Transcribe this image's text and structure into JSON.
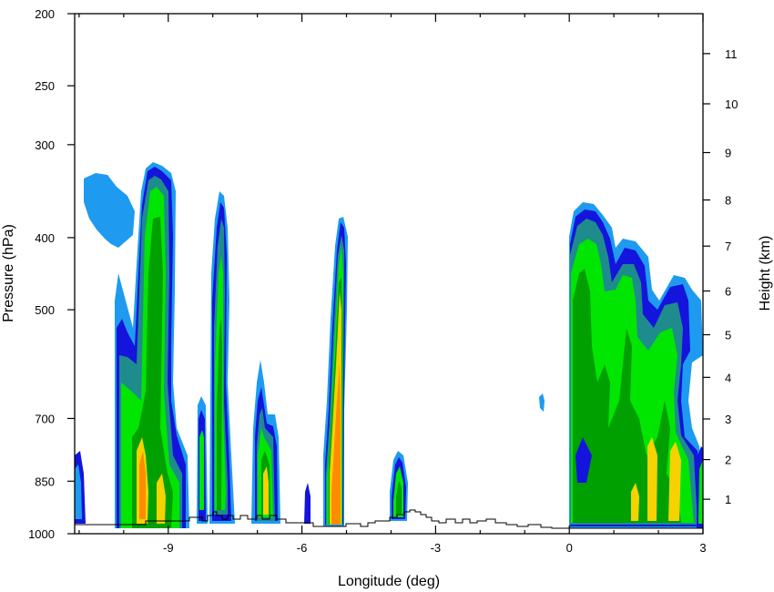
{
  "chart_data": {
    "type": "heatmap",
    "subtype": "filled-contour cross-section",
    "xlabel": "Longitude (deg)",
    "ylabel_left": "Pressure (hPa)",
    "ylabel_right": "Height (km)",
    "x_range": [
      -11.1,
      3.0
    ],
    "x_ticks": [
      -9,
      -6,
      -3,
      0,
      3
    ],
    "x_tick_labels": [
      "-9",
      "-6",
      "-3",
      "0",
      "3"
    ],
    "pressure_range": [
      1000,
      200
    ],
    "pressure_ticks": [
      200,
      250,
      300,
      400,
      500,
      700,
      850,
      1000
    ],
    "pressure_tick_labels": [
      "200",
      "250",
      "300",
      "400",
      "500",
      "700",
      "850",
      "1000"
    ],
    "height_ticks": [
      1,
      2,
      3,
      4,
      5,
      6,
      7,
      8,
      9,
      10,
      11
    ],
    "height_tick_labels": [
      "1",
      "2",
      "3",
      "4",
      "5",
      "6",
      "7",
      "8",
      "9",
      "10",
      "11"
    ],
    "fill_levels_colors": [
      "#1e9bf0",
      "#1414dc",
      "#1e8c8c",
      "#00e600",
      "#00a000",
      "#f5d200",
      "#ff8c00"
    ],
    "terrain_outline_color": "#000000",
    "contour_regions": [
      {
        "x_min": -11.0,
        "x_max": -10.2,
        "p_top": 340,
        "p_bottom": 420,
        "levels": 1
      },
      {
        "x_min": -10.0,
        "x_max": -9.2,
        "p_top": 335,
        "p_bottom": 1000,
        "levels": 7
      },
      {
        "x_min": -8.6,
        "x_max": -8.4,
        "p_top": 680,
        "p_bottom": 1000,
        "levels": 3
      },
      {
        "x_min": -8.3,
        "x_max": -7.8,
        "p_top": 360,
        "p_bottom": 1000,
        "levels": 4
      },
      {
        "x_min": -7.3,
        "x_max": -6.8,
        "p_top": 620,
        "p_bottom": 1000,
        "levels": 5
      },
      {
        "x_min": -5.8,
        "x_max": -5.2,
        "p_top": 380,
        "p_bottom": 1000,
        "levels": 7
      },
      {
        "x_min": -4.1,
        "x_max": -3.7,
        "p_top": 800,
        "p_bottom": 960,
        "levels": 4
      },
      {
        "x_min": -0.8,
        "x_max": -0.7,
        "p_top": 680,
        "p_bottom": 700,
        "levels": 1
      },
      {
        "x_min": 0.0,
        "x_max": 3.0,
        "p_top": 370,
        "p_bottom": 1000,
        "levels": 6
      }
    ]
  }
}
